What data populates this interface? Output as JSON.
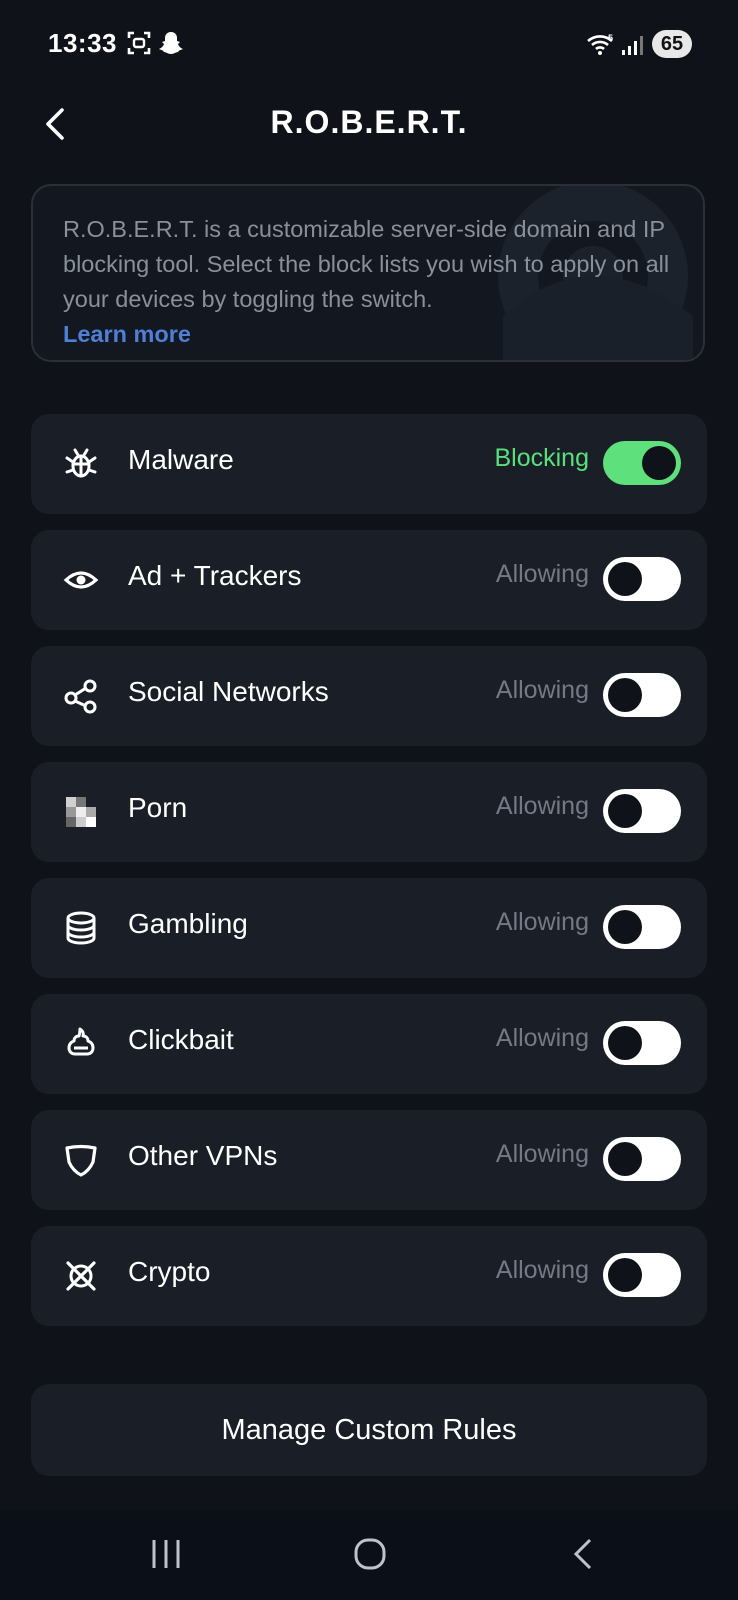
{
  "status_bar": {
    "time": "13:33",
    "battery": "65"
  },
  "header": {
    "title": "R.O.B.E.R.T."
  },
  "info": {
    "text": "R.O.B.E.R.T. is a customizable server-side domain and IP blocking tool. Select the block lists you wish to apply on all your devices by toggling the switch.",
    "link": "Learn more"
  },
  "rows": [
    {
      "label": "Malware",
      "status": "Blocking",
      "on": true,
      "icon": "bug-icon"
    },
    {
      "label": "Ad + Trackers",
      "status": "Allowing",
      "on": false,
      "icon": "eye-icon"
    },
    {
      "label": "Social Networks",
      "status": "Allowing",
      "on": false,
      "icon": "share-nodes-icon"
    },
    {
      "label": "Porn",
      "status": "Allowing",
      "on": false,
      "icon": "pixelated-icon"
    },
    {
      "label": "Gambling",
      "status": "Allowing",
      "on": false,
      "icon": "chip-stack-icon"
    },
    {
      "label": "Clickbait",
      "status": "Allowing",
      "on": false,
      "icon": "poop-icon"
    },
    {
      "label": "Other VPNs",
      "status": "Allowing",
      "on": false,
      "icon": "shield-icon"
    },
    {
      "label": "Crypto",
      "status": "Allowing",
      "on": false,
      "icon": "crypto-icon"
    }
  ],
  "manage_button": {
    "label": "Manage Custom Rules"
  },
  "colors": {
    "background": "#0f1319",
    "card": "#1a1f27",
    "accent_green": "#5ee07c",
    "link_blue": "#4f7fd6"
  }
}
